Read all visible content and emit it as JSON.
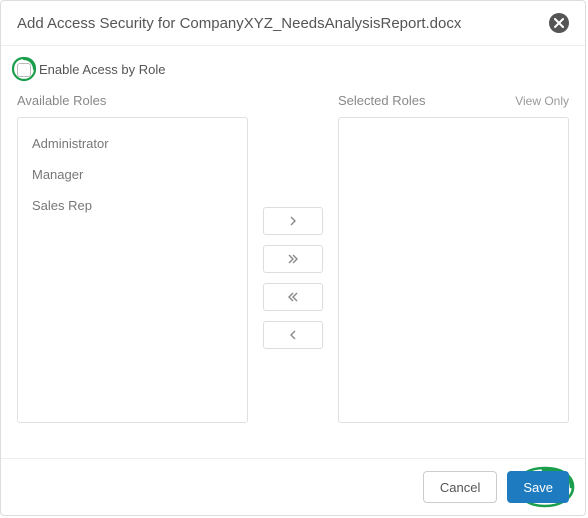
{
  "header": {
    "title": "Add Access Security for CompanyXYZ_NeedsAnalysisReport.docx"
  },
  "enable": {
    "label": "Enable Acess by Role",
    "checked": false
  },
  "available": {
    "header": "Available Roles",
    "items": [
      "Administrator",
      "Manager",
      "Sales Rep"
    ]
  },
  "selected": {
    "header": "Selected Roles",
    "subheader": "View Only",
    "items": []
  },
  "footer": {
    "cancel": "Cancel",
    "save": "Save"
  }
}
